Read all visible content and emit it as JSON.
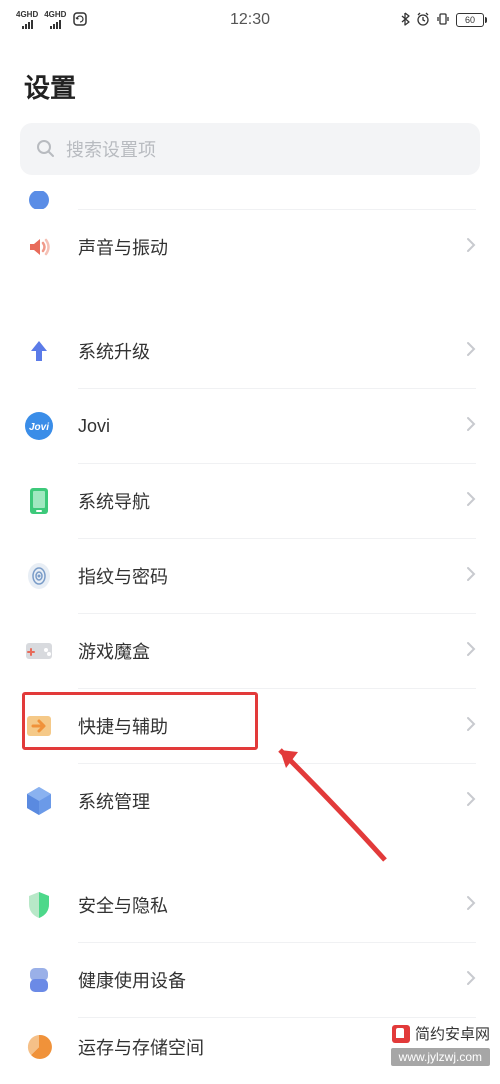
{
  "status": {
    "signal_label": "4GHD",
    "time": "12:30",
    "battery": "60"
  },
  "header": {
    "title": "设置"
  },
  "search": {
    "placeholder": "搜索设置项"
  },
  "items": {
    "sound": "声音与振动",
    "system_upgrade": "系统升级",
    "jovi": "Jovi",
    "system_nav": "系统导航",
    "fingerprint": "指纹与密码",
    "game_box": "游戏魔盒",
    "shortcut": "快捷与辅助",
    "system_manage": "系统管理",
    "security": "安全与隐私",
    "health": "健康使用设备",
    "storage": "运存与存储空间"
  },
  "icons": {
    "sound_color": "#e86b5a",
    "upgrade_color": "#5b7be8",
    "jovi_bg": "#3a8de8",
    "nav_color": "#3dc97a",
    "fingerprint_color": "#9ab4d4",
    "game_color": "#c9ccd0",
    "shortcut_color": "#f09a3a",
    "manage_color": "#5a8ce6",
    "security_color": "#4dd88a",
    "health_color": "#6b8ae6",
    "storage_color": "#f0923a"
  },
  "watermark": {
    "site_name": "简约安卓网",
    "site_url": "www.jylzwj.com"
  }
}
